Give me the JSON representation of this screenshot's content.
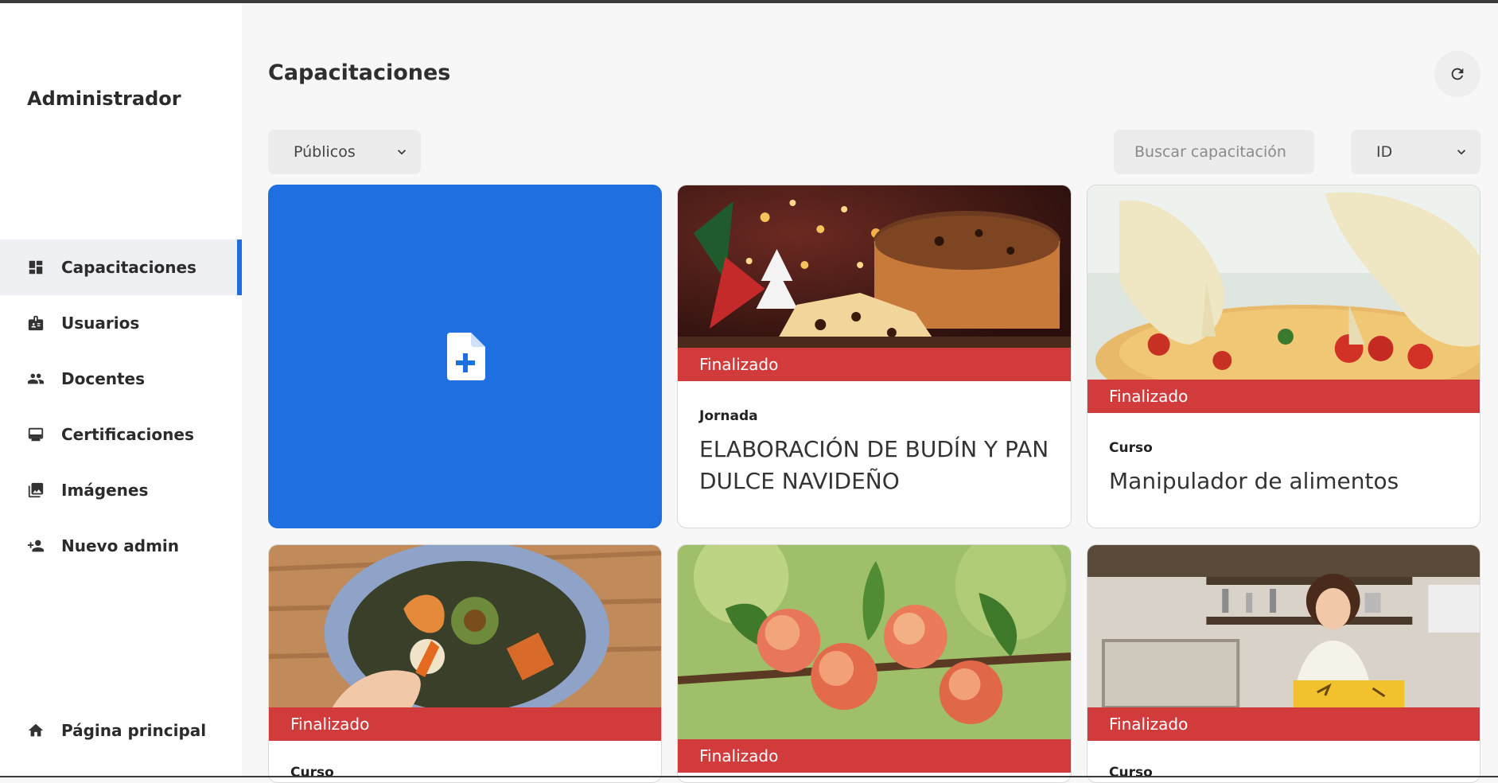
{
  "app": {
    "role_title": "Administrador"
  },
  "sidebar": {
    "items": [
      {
        "label": "Capacitaciones",
        "icon": "dashboard-icon",
        "active": true
      },
      {
        "label": "Usuarios",
        "icon": "badge-icon",
        "active": false
      },
      {
        "label": "Docentes",
        "icon": "group-icon",
        "active": false
      },
      {
        "label": "Certificaciones",
        "icon": "monitor-icon",
        "active": false
      },
      {
        "label": "Imágenes",
        "icon": "photo-library-icon",
        "active": false
      },
      {
        "label": "Nuevo admin",
        "icon": "person-add-icon",
        "active": false
      }
    ],
    "home": {
      "label": "Página principal",
      "icon": "home-icon"
    }
  },
  "main": {
    "title": "Capacitaciones",
    "filter": {
      "selected": "Públicos"
    },
    "search": {
      "placeholder": "Buscar capacitación"
    },
    "sort": {
      "selected": "ID"
    },
    "accent_color": "#1e6fe0",
    "status_color": "#d23b3b",
    "cards": [
      {
        "kind": "create",
        "icon": "add-file-icon"
      },
      {
        "status": "Finalizado",
        "type": "Jornada",
        "title": "ELABORACIÓN DE BUDÍN Y PAN DULCE NAVIDEÑO",
        "image": "panettone-christmas-photo"
      },
      {
        "status": "Finalizado",
        "type": "Curso",
        "title": "Manipulador de alimentos",
        "image": "gloved-hands-pizza-photo"
      },
      {
        "status": "Finalizado",
        "type": "Curso",
        "title": "",
        "image": "compost-bin-photo"
      },
      {
        "status": "Finalizado",
        "type": "",
        "title": "",
        "image": "peaches-branch-photo"
      },
      {
        "status": "Finalizado",
        "type": "Curso",
        "title": "",
        "image": "woman-shop-counter-photo"
      }
    ]
  }
}
